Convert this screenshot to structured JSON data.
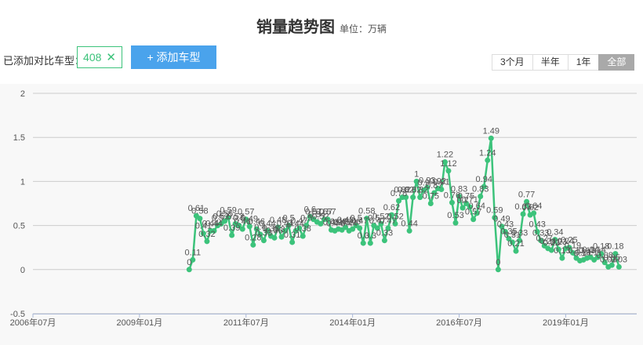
{
  "header": {
    "title": "销量趋势图",
    "unit": "单位：万辆"
  },
  "compare": {
    "label": "已添加对比车型：",
    "model": "408",
    "add_button": "+ 添加车型"
  },
  "ranges": [
    {
      "label": "3个月",
      "active": false
    },
    {
      "label": "半年",
      "active": false
    },
    {
      "label": "1年",
      "active": false
    },
    {
      "label": "全部",
      "active": true
    }
  ],
  "colors": {
    "series": "#3cc37b",
    "accent": "#4aa3ec",
    "grid": "#cccccc"
  },
  "chart_data": {
    "type": "line",
    "ylim": [
      -0.5,
      2
    ],
    "yticks": [
      -0.5,
      0,
      0.5,
      1,
      1.5,
      2
    ],
    "xlim": [
      "2006-07",
      "2020-09"
    ],
    "xticks": [
      "2006年07月",
      "2009年01月",
      "2011年07月",
      "2014年01月",
      "2016年07月",
      "2019年01月"
    ],
    "grid": true,
    "series": [
      {
        "x": [
          "2010-03",
          "2010-04",
          "2010-05",
          "2010-06",
          "2010-07",
          "2010-08",
          "2010-09",
          "2010-10",
          "2010-11",
          "2010-12",
          "2011-01",
          "2011-02",
          "2011-03",
          "2011-04",
          "2011-05",
          "2011-06",
          "2011-07",
          "2011-08",
          "2011-09",
          "2011-10",
          "2011-11",
          "2011-12",
          "2012-01",
          "2012-02",
          "2012-03",
          "2012-04",
          "2012-05",
          "2012-06",
          "2012-07",
          "2012-08",
          "2012-09",
          "2012-10",
          "2012-11",
          "2012-12",
          "2013-01",
          "2013-02",
          "2013-03",
          "2013-04",
          "2013-05",
          "2013-06",
          "2013-07",
          "2013-08",
          "2013-09",
          "2013-10",
          "2013-11",
          "2013-12",
          "2014-01",
          "2014-02",
          "2014-03",
          "2014-04",
          "2014-05",
          "2014-06",
          "2014-07",
          "2014-08",
          "2014-09",
          "2014-10",
          "2014-11",
          "2014-12",
          "2015-01",
          "2015-02",
          "2015-03",
          "2015-04",
          "2015-05",
          "2015-06",
          "2015-07",
          "2015-08",
          "2015-09",
          "2015-10",
          "2015-11",
          "2015-12",
          "2016-01",
          "2016-02",
          "2016-03",
          "2016-04",
          "2016-05",
          "2016-06",
          "2016-07",
          "2016-08",
          "2016-09",
          "2016-10",
          "2016-11",
          "2016-12",
          "2017-01",
          "2017-02",
          "2017-03",
          "2017-04",
          "2017-05",
          "2017-06",
          "2017-07",
          "2017-08",
          "2017-09",
          "2017-10",
          "2017-11",
          "2017-12",
          "2018-01",
          "2018-02",
          "2018-03",
          "2018-04",
          "2018-05",
          "2018-06",
          "2018-07",
          "2018-08",
          "2018-09",
          "2018-10",
          "2018-11",
          "2018-12",
          "2019-01",
          "2019-02",
          "2019-03",
          "2019-04",
          "2019-05",
          "2019-06",
          "2019-07",
          "2019-08",
          "2019-09",
          "2019-10",
          "2019-11",
          "2019-12",
          "2020-01",
          "2020-02",
          "2020-03",
          "2020-04"
        ],
        "values": [
          0,
          0.11,
          0.61,
          0.58,
          0.41,
          0.32,
          0.44,
          0.44,
          0.5,
          0.52,
          0.55,
          0.59,
          0.39,
          0.52,
          0.5,
          0.46,
          0.57,
          0.49,
          0.28,
          0.46,
          0.4,
          0.33,
          0.44,
          0.38,
          0.36,
          0.48,
          0.37,
          0.44,
          0.5,
          0.31,
          0.44,
          0.47,
          0.38,
          0.5,
          0.6,
          0.57,
          0.54,
          0.52,
          0.57,
          0.57,
          0.45,
          0.44,
          0.46,
          0.45,
          0.48,
          0.44,
          0.46,
          0.5,
          0.47,
          0.3,
          0.58,
          0.3,
          0.5,
          0.47,
          0.52,
          0.33,
          0.47,
          0.62,
          0.52,
          0.78,
          0.82,
          0.82,
          0.44,
          0.82,
          1,
          0.82,
          0.9,
          0.93,
          0.75,
          0.87,
          0.92,
          0.91,
          1.22,
          1.12,
          0.76,
          0.53,
          0.83,
          0.7,
          0.75,
          0.71,
          0.57,
          0.64,
          0.83,
          0.94,
          1.24,
          1.49,
          0.59,
          0,
          0.49,
          0.43,
          0.35,
          0.31,
          0.21,
          0.33,
          0.63,
          0.77,
          0.62,
          0.64,
          0.43,
          0.33,
          0.27,
          0.24,
          0.22,
          0.34,
          0.23,
          0.13,
          0.24,
          0.25,
          0.19,
          0.13,
          0.1,
          0.11,
          0.13,
          0.14,
          0.11,
          0.14,
          0.18,
          0.08,
          0.03,
          0.05,
          0.18,
          0.03
        ]
      }
    ]
  }
}
